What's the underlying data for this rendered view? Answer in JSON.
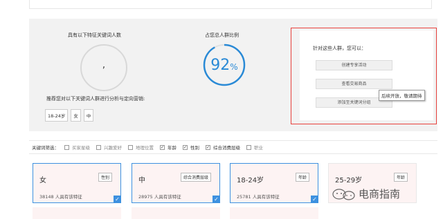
{
  "stats": {
    "count_title": "具有以下特征关键词人数",
    "count_value": ",",
    "ratio_title": "占您总人群比例",
    "ratio_value": "92",
    "ratio_unit": "%",
    "ratio_fraction": 0.92
  },
  "recommend": {
    "text": "推荐您对以下关键词人群进行分析与定向营销:",
    "tags": [
      "18-24岁",
      "女",
      "中"
    ]
  },
  "actions": {
    "title": "针对这些人群，您可以：",
    "buttons": [
      "创建专享活动",
      "查看交易商品",
      "添加至关键词分组"
    ],
    "tooltip": "后续开放，敬请期待"
  },
  "filter": {
    "label": "关键词筛选：",
    "options": [
      {
        "label": "买家星级",
        "checked": false
      },
      {
        "label": "兴趣爱好",
        "checked": false
      },
      {
        "label": "地理位置",
        "checked": false
      },
      {
        "label": "年龄",
        "checked": true
      },
      {
        "label": "性别",
        "checked": true
      },
      {
        "label": "综合消费层级",
        "checked": true
      },
      {
        "label": "职业",
        "checked": false
      }
    ]
  },
  "cards": [
    {
      "label": "女",
      "tag": "性别",
      "count": "38148 人具有该特征",
      "selected": true
    },
    {
      "label": "中",
      "tag": "综合消费层级",
      "count": "28975 人具有该特征",
      "selected": true
    },
    {
      "label": "18-24岁",
      "tag": "年龄",
      "count": "25781 人具有该特征",
      "selected": true
    },
    {
      "label": "25-29岁",
      "tag": "年龄",
      "count": "",
      "selected": false
    }
  ],
  "watermark": {
    "text": "电商指南"
  },
  "colors": {
    "accent": "#2a8ad6",
    "highlight_border": "#e8413c",
    "card_bg": "#fdf3f3"
  }
}
